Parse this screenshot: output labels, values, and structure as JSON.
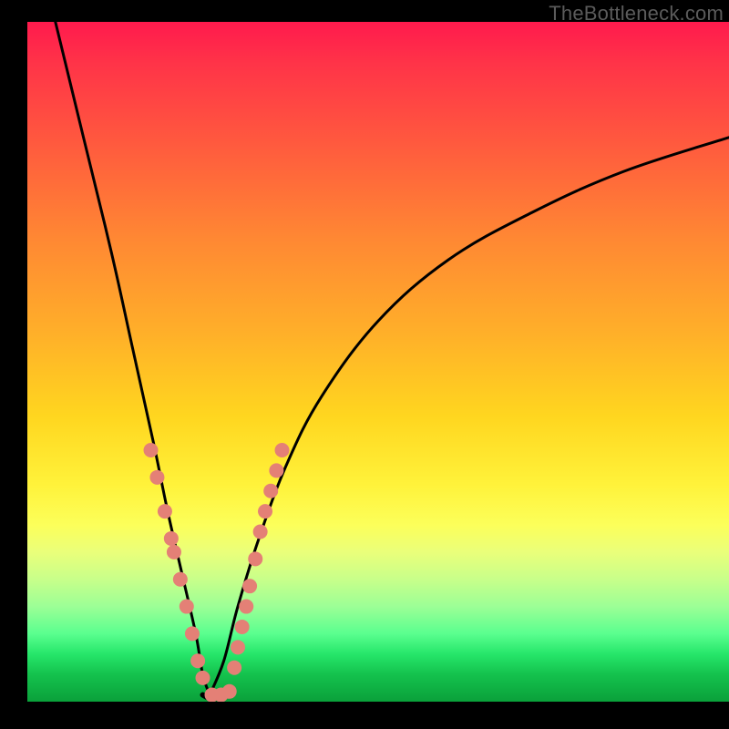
{
  "watermark": "TheBottleneck.com",
  "chart_data": {
    "type": "line",
    "title": "",
    "xlabel": "",
    "ylabel": "",
    "xlim": [
      0,
      100
    ],
    "ylim": [
      0,
      100
    ],
    "note": "V-shaped bottleneck curve over a vertical green-yellow-red gradient. Left branch descends steeply from top-left into a trough near x≈26, right branch rises with decreasing slope toward the right edge. Pink markers cluster on both flanks near the trough.",
    "series": [
      {
        "name": "left-branch",
        "x": [
          4,
          8,
          12,
          15,
          18,
          20,
          22,
          24,
          25,
          26
        ],
        "y": [
          100,
          83,
          66,
          52,
          38,
          28,
          19,
          10,
          4,
          1
        ]
      },
      {
        "name": "right-branch",
        "x": [
          26,
          28,
          30,
          33,
          37,
          42,
          50,
          60,
          72,
          85,
          100
        ],
        "y": [
          1,
          6,
          14,
          24,
          35,
          45,
          56,
          65,
          72,
          78,
          83
        ]
      },
      {
        "name": "trough",
        "x": [
          25,
          26,
          27,
          28
        ],
        "y": [
          1,
          0.5,
          0.5,
          1
        ]
      }
    ],
    "markers": {
      "name": "highlight-dots",
      "color": "#e48076",
      "points": [
        {
          "x": 17.6,
          "y": 37
        },
        {
          "x": 18.5,
          "y": 33
        },
        {
          "x": 19.6,
          "y": 28
        },
        {
          "x": 20.5,
          "y": 24
        },
        {
          "x": 20.9,
          "y": 22
        },
        {
          "x": 21.8,
          "y": 18
        },
        {
          "x": 22.7,
          "y": 14
        },
        {
          "x": 23.5,
          "y": 10
        },
        {
          "x": 24.3,
          "y": 6
        },
        {
          "x": 25.0,
          "y": 3.5
        },
        {
          "x": 26.3,
          "y": 1.0
        },
        {
          "x": 27.6,
          "y": 1.0
        },
        {
          "x": 28.8,
          "y": 1.5
        },
        {
          "x": 29.5,
          "y": 5
        },
        {
          "x": 30.0,
          "y": 8
        },
        {
          "x": 30.6,
          "y": 11
        },
        {
          "x": 31.2,
          "y": 14
        },
        {
          "x": 31.7,
          "y": 17
        },
        {
          "x": 32.5,
          "y": 21
        },
        {
          "x": 33.2,
          "y": 25
        },
        {
          "x": 33.9,
          "y": 28
        },
        {
          "x": 34.7,
          "y": 31
        },
        {
          "x": 35.5,
          "y": 34
        },
        {
          "x": 36.3,
          "y": 37
        }
      ]
    }
  }
}
